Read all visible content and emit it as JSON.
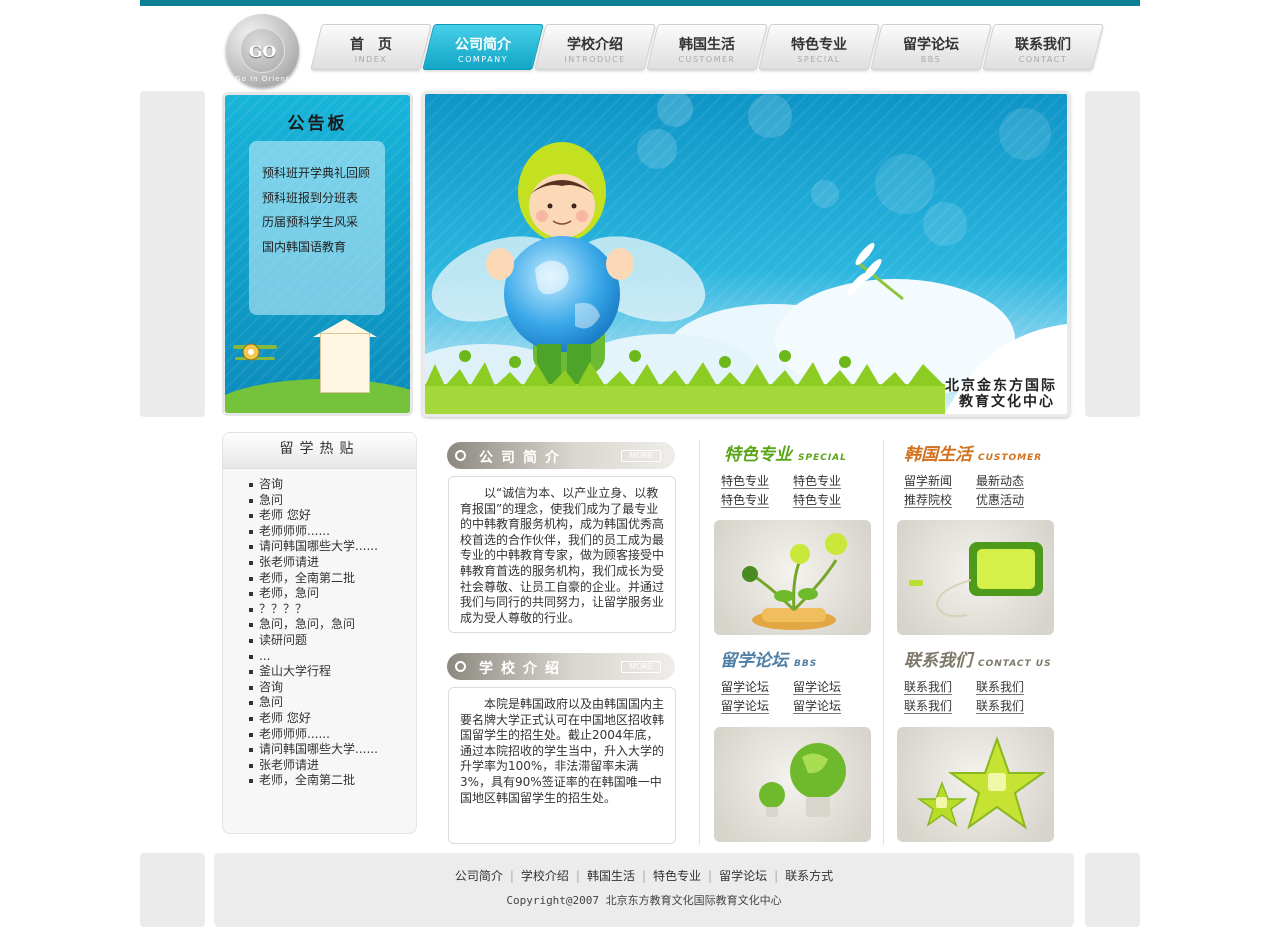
{
  "brand": {
    "logo_text": "GO",
    "logo_ring_text": "Go In Orient"
  },
  "nav": [
    {
      "cn": "首　页",
      "en": "INDEX",
      "active": false
    },
    {
      "cn": "公司简介",
      "en": "COMPANY",
      "active": true
    },
    {
      "cn": "学校介绍",
      "en": "INTRODUCE",
      "active": false
    },
    {
      "cn": "韩国生活",
      "en": "CUSTOMER",
      "active": false
    },
    {
      "cn": "特色专业",
      "en": "SPECIAL",
      "active": false
    },
    {
      "cn": "留学论坛",
      "en": "BBS",
      "active": false
    },
    {
      "cn": "联系我们",
      "en": "CONTACT",
      "active": false
    }
  ],
  "notice": {
    "title": "公告板",
    "items": [
      "预科班开学典礼回顾",
      "预科班报到分班表",
      "历届预科学生风采",
      "国内韩国语教育"
    ]
  },
  "banner": {
    "caption_line1": "北京金东方国际",
    "caption_line2": "教育文化中心"
  },
  "hot_posts": {
    "title": "留学热贴",
    "items": [
      "咨询",
      "急问",
      "老师 您好",
      "老师师师......",
      "请问韩国哪些大学......",
      "张老师请进",
      "老师，全南第二批",
      "老师，急问",
      "？？？？",
      "急问，急问，急问",
      "读研问题",
      "...",
      "釜山大学行程",
      "咨询",
      "急问",
      "老师 您好",
      "老师师师......",
      "请问韩国哪些大学......",
      "张老师请进",
      "老师，全南第二批"
    ]
  },
  "company": {
    "title": "公司简介",
    "more": "MORE",
    "text": "以“诚信为本、以产业立身、以教育报国”的理念，使我们成为了最专业的中韩教育服务机构，成为韩国优秀高校首选的合作伙伴，我们的员工成为最专业的中韩教育专家，做为顾客接受中韩教育首选的服务机构，我们成长为受社会尊敬、让员工自豪的企业。并通过我们与同行的共同努力，让留学服务业成为受人尊敬的行业。"
  },
  "school": {
    "title": "学校介绍",
    "more": "MORE",
    "text": "本院是韩国政府以及由韩国国内主要名牌大学正式认可在中国地区招收韩国留学生的招生处。截止2004年底，通过本院招收的学生当中，升入大学的升学率为100%，非法滞留率未满3%，具有90%签证率的在韩国唯一中国地区韩国留学生的招生处。"
  },
  "special": {
    "title": "特色专业",
    "sub": "SPECIAL",
    "links": [
      "特色专业",
      "特色专业",
      "特色专业",
      "特色专业"
    ]
  },
  "korea_life": {
    "title": "韩国生活",
    "sub": "CUSTOMER",
    "links": [
      "留学新闻",
      "最新动态",
      "推荐院校",
      "优惠活动"
    ]
  },
  "bbs": {
    "title": "留学论坛",
    "sub": "BBS",
    "links": [
      "留学论坛",
      "留学论坛",
      "留学论坛",
      "留学论坛"
    ]
  },
  "contact": {
    "title": "联系我们",
    "sub": "CONTACT US",
    "links": [
      "联系我们",
      "联系我们",
      "联系我们",
      "联系我们"
    ]
  },
  "footer": {
    "links": [
      "公司简介",
      "学校介绍",
      "韩国生活",
      "特色专业",
      "留学论坛",
      "联系方式"
    ],
    "copyright": "Copyright@2007 北京东方教育文化国际教育文化中心"
  },
  "colors": {
    "accent": "#0a7f95",
    "special": "#5aa419",
    "korea_life": "#d2701c",
    "bbs": "#4f7fa5",
    "contact": "#7d7867"
  }
}
